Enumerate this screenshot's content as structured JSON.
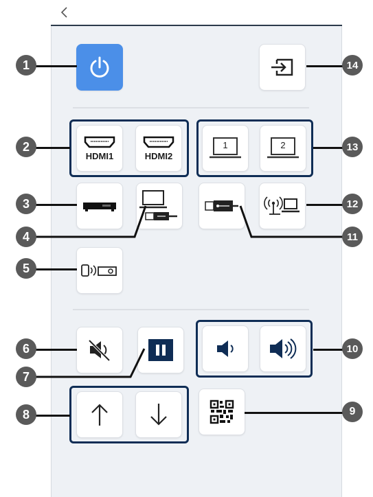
{
  "header": {
    "back_label": "back"
  },
  "buttons": {
    "power": {
      "icon": "power-icon"
    },
    "source_search": {
      "icon": "source-search-icon"
    },
    "hdmi1": {
      "label": "HDMI1",
      "icon": "hdmi-port-icon"
    },
    "hdmi2": {
      "label": "HDMI2",
      "icon": "hdmi-port-icon"
    },
    "computer1": {
      "label": "1",
      "icon": "laptop-icon"
    },
    "computer2": {
      "label": "2",
      "icon": "laptop-icon"
    },
    "video_device": {
      "icon": "video-player-icon"
    },
    "usb_display": {
      "icon": "laptop-usb-icon"
    },
    "usb_memory": {
      "icon": "usb-drive-icon"
    },
    "network": {
      "icon": "network-icon"
    },
    "screen_mirroring": {
      "icon": "screen-mirroring-icon"
    },
    "mute": {
      "icon": "av-mute-icon"
    },
    "freeze": {
      "icon": "freeze-icon"
    },
    "volume_down": {
      "icon": "volume-down-icon"
    },
    "volume_up": {
      "icon": "volume-up-icon"
    },
    "page_up": {
      "icon": "arrow-up-icon"
    },
    "page_down": {
      "icon": "arrow-down-icon"
    },
    "qr_code": {
      "icon": "qr-code-icon"
    }
  },
  "callouts": [
    "1",
    "2",
    "3",
    "4",
    "5",
    "6",
    "7",
    "8",
    "9",
    "10",
    "11",
    "12",
    "13",
    "14"
  ],
  "colors": {
    "accent": "#4b8fe8",
    "group_border": "#0f2d55",
    "callout": "#5a5a5a"
  }
}
